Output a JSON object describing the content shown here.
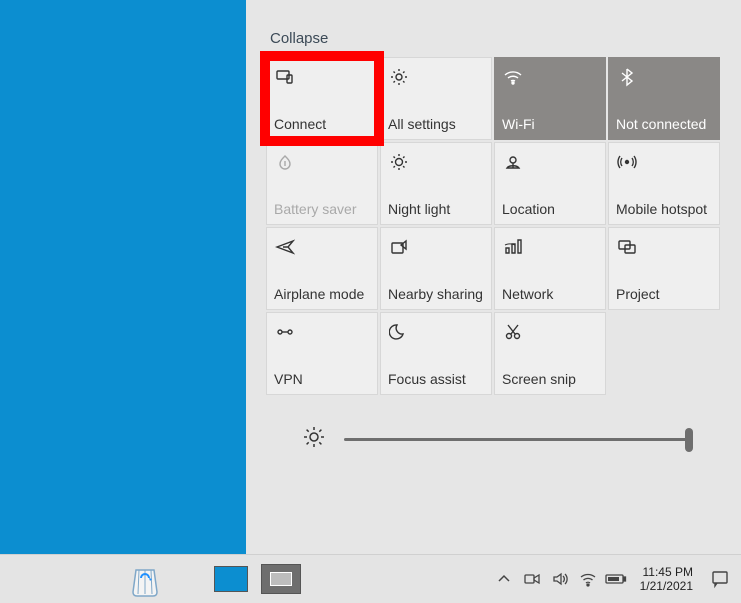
{
  "panel": {
    "collapse_label": "Collapse",
    "tiles": [
      {
        "id": "connect",
        "label": "Connect",
        "icon": "connect-icon",
        "active": false,
        "disabled": false,
        "highlighted": true
      },
      {
        "id": "all-settings",
        "label": "All settings",
        "icon": "gear-icon",
        "active": false,
        "disabled": false
      },
      {
        "id": "wifi",
        "label": "Wi-Fi",
        "icon": "wifi-icon",
        "active": true,
        "disabled": false
      },
      {
        "id": "bluetooth",
        "label": "Not connected",
        "icon": "bluetooth-icon",
        "active": true,
        "disabled": false
      },
      {
        "id": "battery-saver",
        "label": "Battery saver",
        "icon": "battery-saver-icon",
        "active": false,
        "disabled": true
      },
      {
        "id": "night-light",
        "label": "Night light",
        "icon": "sun-icon",
        "active": false,
        "disabled": false
      },
      {
        "id": "location",
        "label": "Location",
        "icon": "location-icon",
        "active": false,
        "disabled": false
      },
      {
        "id": "mobile-hotspot",
        "label": "Mobile hotspot",
        "icon": "hotspot-icon",
        "active": false,
        "disabled": false
      },
      {
        "id": "airplane-mode",
        "label": "Airplane mode",
        "icon": "airplane-icon",
        "active": false,
        "disabled": false
      },
      {
        "id": "nearby-sharing",
        "label": "Nearby sharing",
        "icon": "share-icon",
        "active": false,
        "disabled": false
      },
      {
        "id": "network",
        "label": "Network",
        "icon": "network-icon",
        "active": false,
        "disabled": false
      },
      {
        "id": "project",
        "label": "Project",
        "icon": "project-icon",
        "active": false,
        "disabled": false
      },
      {
        "id": "vpn",
        "label": "VPN",
        "icon": "vpn-icon",
        "active": false,
        "disabled": false
      },
      {
        "id": "focus-assist",
        "label": "Focus assist",
        "icon": "moon-icon",
        "active": false,
        "disabled": false
      },
      {
        "id": "screen-snip",
        "label": "Screen snip",
        "icon": "snip-icon",
        "active": false,
        "disabled": false
      }
    ],
    "brightness_value": 100
  },
  "taskbar": {
    "time": "11:45 PM",
    "date": "1/21/2021"
  }
}
